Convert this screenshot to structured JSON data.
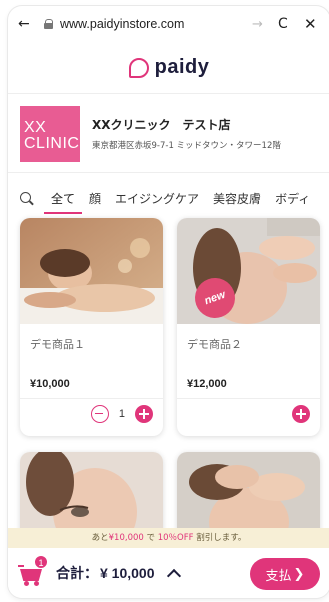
{
  "browser": {
    "back_glyph": "←",
    "url": "www.paidyinstore.com",
    "forward_glyph": "→",
    "reload_glyph": "C",
    "close_glyph": "✕"
  },
  "brand": {
    "logo_text": "paidy"
  },
  "store": {
    "logo_line1": "XX",
    "logo_line2": "CLINIC",
    "name": "XXクリニック　テスト店",
    "address": "東京都港区赤坂9-7-1 ミッドタウン・タワー12階"
  },
  "tabs": [
    {
      "label": "全て",
      "active": true
    },
    {
      "label": "顔"
    },
    {
      "label": "エイジングケア"
    },
    {
      "label": "美容皮膚"
    },
    {
      "label": "ボディ"
    }
  ],
  "products": [
    {
      "name": "デモ商品１",
      "price": "¥10,000",
      "qty": "1",
      "badge": ""
    },
    {
      "name": "デモ商品２",
      "price": "¥12,000",
      "qty": "",
      "badge": "new"
    }
  ],
  "promo": {
    "prefix": "あと",
    "amount": "¥10,000",
    "middle": "で",
    "discount": "10％OFF",
    "suffix": "割引します。"
  },
  "footer": {
    "cart_count": "1",
    "total_label": "合計：",
    "total_value": "¥ 10,000",
    "pay_label": "支払",
    "pay_arrow": "❯"
  },
  "colors": {
    "accent": "#e0357a",
    "navy": "#1e1e3c",
    "promo_bg": "#f7efd6"
  }
}
